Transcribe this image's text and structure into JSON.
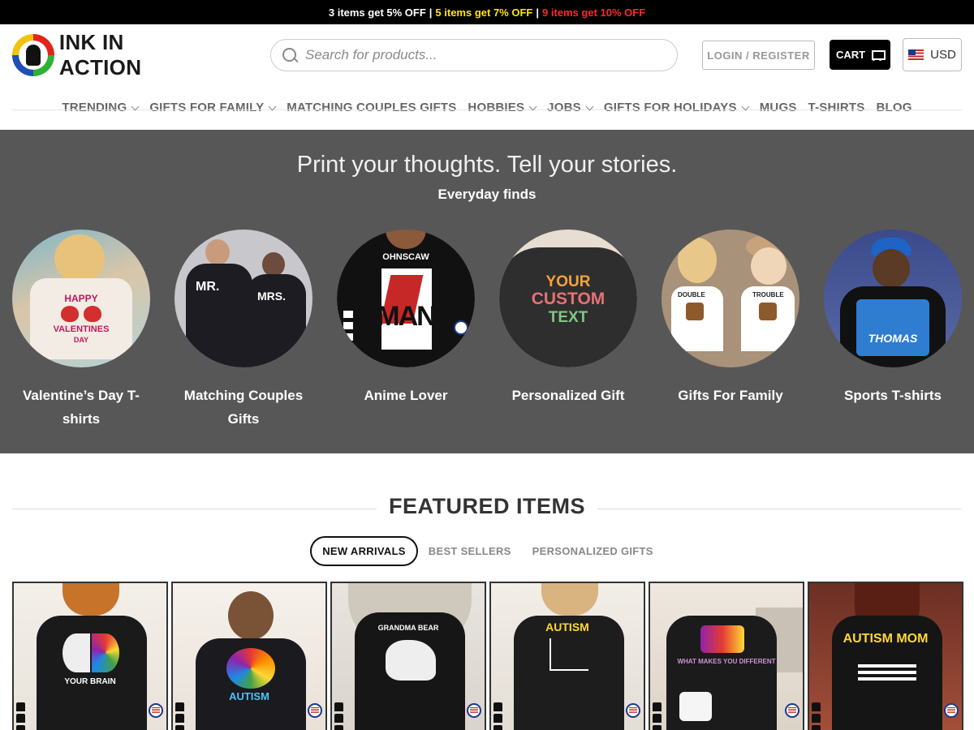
{
  "promo": {
    "p1": "3 items get 5% OFF",
    "sep": "|",
    "p2": "5 items get 7% OFF",
    "p3": "9 items get 10% OFF",
    "colors": {
      "p1": "#ffffff",
      "p2": "#ffe600",
      "p3": "#ff2a2a"
    }
  },
  "header": {
    "logo_text": "INK IN ACTION",
    "search_placeholder": "Search for products...",
    "search_value": "",
    "login_label": "LOGIN / REGISTER",
    "cart_label": "CART",
    "currency": "USD"
  },
  "nav": {
    "items": [
      {
        "label": "TRENDING",
        "dropdown": true
      },
      {
        "label": "GIFTS FOR FAMILY",
        "dropdown": true
      },
      {
        "label": "MATCHING COUPLES GIFTS",
        "dropdown": false
      },
      {
        "label": "HOBBIES",
        "dropdown": true
      },
      {
        "label": "JOBS",
        "dropdown": true
      },
      {
        "label": "GIFTS FOR HOLIDAYS",
        "dropdown": true
      },
      {
        "label": "MUGS",
        "dropdown": false
      },
      {
        "label": "T-SHIRTS",
        "dropdown": false
      },
      {
        "label": "BLOG",
        "dropdown": false
      }
    ]
  },
  "hero": {
    "title": "Print your thoughts. Tell your stories.",
    "subtitle": "Everyday finds",
    "background": "#575757",
    "categories": [
      {
        "label": "Valentine’s Day T-shirts",
        "image_text": [
          "HAPPY",
          "VALENTINES",
          "DAY"
        ]
      },
      {
        "label": "Matching Couples Gifts",
        "image_text": [
          "MR.",
          "MRS."
        ]
      },
      {
        "label": "Anime Lover",
        "image_text": [
          "OHNSCAW",
          "MAN"
        ]
      },
      {
        "label": "Personalized Gift",
        "image_text": [
          "YOUR",
          "CUSTOM",
          "TEXT"
        ]
      },
      {
        "label": "Gifts For Family",
        "image_text": [
          "DOUBLE",
          "TROUBLE"
        ]
      },
      {
        "label": "Sports T-shirts",
        "image_text": [
          "THOMAS"
        ]
      }
    ]
  },
  "featured": {
    "title": "FEATURED ITEMS",
    "tabs": [
      "NEW ARRIVALS",
      "BEST SELLERS",
      "PERSONALIZED GIFTS"
    ],
    "active_tab": 0,
    "products": [
      {
        "image_text": "YOUR BRAIN"
      },
      {
        "image_text": "AUTISM"
      },
      {
        "image_text": "GRANDMA BEAR"
      },
      {
        "image_text": "AUTISM"
      },
      {
        "image_text": "WHAT MAKES YOU DIFFERENT"
      },
      {
        "image_text": "AUTISM MOM"
      }
    ]
  }
}
